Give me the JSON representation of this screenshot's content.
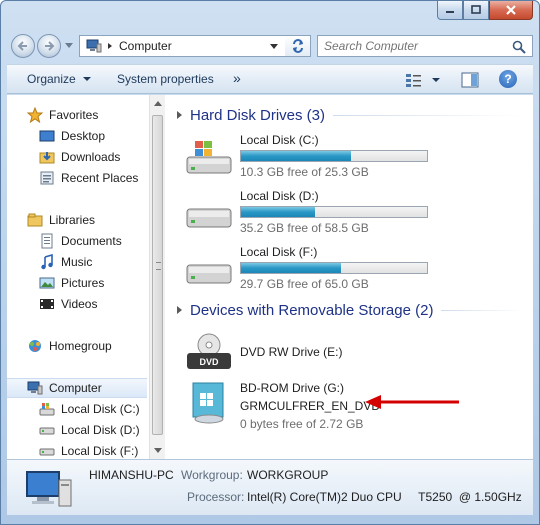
{
  "window": {
    "colors": {
      "frame": "#b9d1ea",
      "group_header": "#1e3287",
      "bar_fill": "#2a98c6",
      "annotation_arrow": "#d40000"
    }
  },
  "address": {
    "crumb": "Computer",
    "search_placeholder": "Search Computer"
  },
  "toolbar": {
    "organize": "Organize",
    "system_properties": "System properties",
    "more": "»"
  },
  "nav": {
    "favorites": "Favorites",
    "favorites_items": [
      "Desktop",
      "Downloads",
      "Recent Places"
    ],
    "libraries": "Libraries",
    "libraries_items": [
      "Documents",
      "Music",
      "Pictures",
      "Videos"
    ],
    "homegroup": "Homegroup",
    "computer": "Computer",
    "computer_items": [
      "Local Disk (C:)",
      "Local Disk (D:)",
      "Local Disk (F:)"
    ]
  },
  "main": {
    "hard_disk_header": "Hard Disk Drives (3)",
    "removable_header": "Devices with Removable Storage (2)",
    "hard_disks": [
      {
        "name": "Local Disk (C:)",
        "free": "10.3 GB free of 25.3 GB",
        "used_fraction": 0.59
      },
      {
        "name": "Local Disk (D:)",
        "free": "35.2 GB free of 58.5 GB",
        "used_fraction": 0.4
      },
      {
        "name": "Local Disk (F:)",
        "free": "29.7 GB free of 65.0 GB",
        "used_fraction": 0.54
      }
    ],
    "removable": [
      {
        "name": "DVD RW Drive (E:)",
        "icon_label": "DVD"
      },
      {
        "name": "BD-ROM Drive (G:)",
        "label": "GRMCULFRER_EN_DVD",
        "free": "0 bytes free of 2.72 GB"
      }
    ]
  },
  "details": {
    "pc_name": "HIMANSHU-PC",
    "workgroup_label": "Workgroup:",
    "workgroup_value": "WORKGROUP",
    "processor_label": "Processor:",
    "processor_value": "Intel(R) Core(TM)2 Duo CPU     T5250  @ 1.50GHz"
  }
}
